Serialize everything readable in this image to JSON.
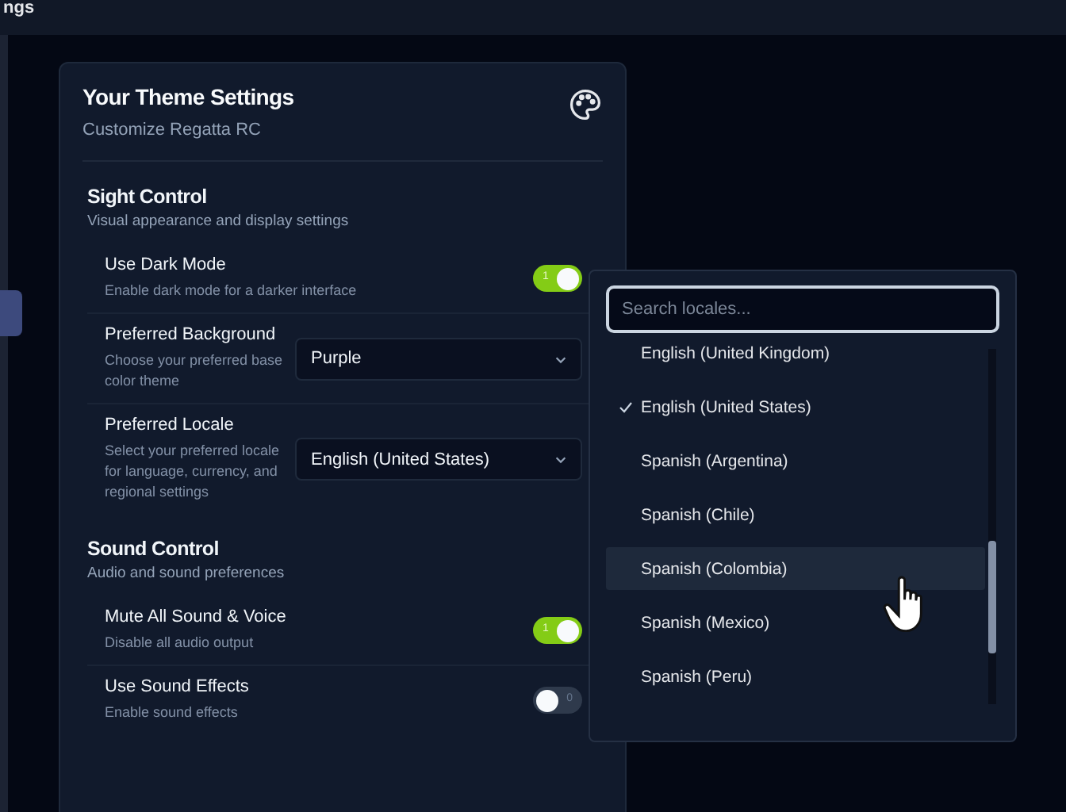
{
  "top_bar": {
    "title": "ngs"
  },
  "card": {
    "title": "Your Theme Settings",
    "subtitle": "Customize Regatta RC",
    "sections": [
      {
        "title": "Sight Control",
        "subtitle": "Visual appearance and display settings",
        "rows": [
          {
            "kind": "toggle",
            "label": "Use Dark Mode",
            "description": "Enable dark mode for a darker interface",
            "on": true,
            "indicator": "1"
          },
          {
            "kind": "select",
            "label": "Preferred Background",
            "description": "Choose your preferred base color theme",
            "value": "Purple"
          },
          {
            "kind": "select",
            "label": "Preferred Locale",
            "description": "Select your preferred locale for language, currency, and regional settings",
            "value": "English (United States)"
          }
        ]
      },
      {
        "title": "Sound Control",
        "subtitle": "Audio and sound preferences",
        "rows": [
          {
            "kind": "toggle",
            "label": "Mute All Sound & Voice",
            "description": "Disable all audio output",
            "on": true,
            "indicator": "1"
          },
          {
            "kind": "toggle",
            "label": "Use Sound Effects",
            "description": "Enable sound effects",
            "on": false,
            "indicator": "0"
          }
        ]
      }
    ]
  },
  "locale_dropdown": {
    "search": {
      "placeholder": "Search locales..."
    },
    "options": [
      {
        "label": "English (United Kingdom)",
        "selected": false,
        "highlighted": false
      },
      {
        "label": "English (United States)",
        "selected": true,
        "highlighted": false
      },
      {
        "label": "Spanish (Argentina)",
        "selected": false,
        "highlighted": false
      },
      {
        "label": "Spanish (Chile)",
        "selected": false,
        "highlighted": false
      },
      {
        "label": "Spanish (Colombia)",
        "selected": false,
        "highlighted": true
      },
      {
        "label": "Spanish (Mexico)",
        "selected": false,
        "highlighted": false
      },
      {
        "label": "Spanish (Peru)",
        "selected": false,
        "highlighted": false
      }
    ]
  }
}
